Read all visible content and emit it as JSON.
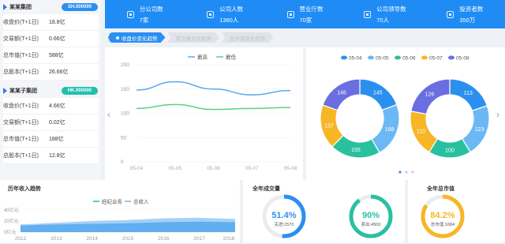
{
  "groups": [
    {
      "name": "某某集团",
      "code": "SH.000000",
      "metrics": [
        {
          "label": "收盘价(T+1日)",
          "value": "18.8亿"
        },
        {
          "label": "交易额(T+1日)",
          "value": "0.66亿"
        },
        {
          "label": "总市值(T+1日)",
          "value": "588亿"
        },
        {
          "label": "总股本(T+1日)",
          "value": "26.66亿"
        }
      ]
    },
    {
      "name": "某某子集团",
      "code": "HK.000000",
      "metrics": [
        {
          "label": "收盘价(T+1日)",
          "value": "4.66亿"
        },
        {
          "label": "交易额(T+1日)",
          "value": "0.02亿"
        },
        {
          "label": "总市值(T+1日)",
          "value": "188亿"
        },
        {
          "label": "总股本(T+1日)",
          "value": "12.8亿"
        }
      ]
    }
  ],
  "stats": [
    {
      "label": "分公司数",
      "value": "7家",
      "icon": "building-icon"
    },
    {
      "label": "公司人数",
      "value": "1360人",
      "icon": "people-icon"
    },
    {
      "label": "营业厅数",
      "value": "70家",
      "icon": "store-icon"
    },
    {
      "label": "公司领导数",
      "value": "70人",
      "icon": "leader-icon"
    },
    {
      "label": "投资者数",
      "value": "350万",
      "icon": "investor-icon"
    }
  ],
  "tabs": [
    {
      "label": "收盘价变化趋势",
      "active": true
    },
    {
      "label": "成交量变化趋势",
      "active": false
    },
    {
      "label": "总市值变化趋势",
      "active": false
    }
  ],
  "line_chart": {
    "legend": [
      "最高",
      "最低"
    ],
    "colors": [
      "#5aaaf0",
      "#5cd08a"
    ],
    "x": [
      "05-04",
      "05-05",
      "05-06",
      "05-07",
      "05-08"
    ],
    "y_ticks": [
      "200",
      "150",
      "100",
      "50",
      "0"
    ],
    "ylim": [
      0,
      200
    ],
    "series": [
      {
        "name": "最高",
        "values": [
          148,
          165,
          150,
          138,
          147
        ]
      },
      {
        "name": "最低",
        "values": [
          110,
          118,
          108,
          110,
          112
        ]
      }
    ]
  },
  "donut_chart": {
    "legend": [
      "05-04",
      "05-05",
      "05-06",
      "05-07",
      "05-08"
    ],
    "colors": [
      "#2b8ff0",
      "#6cb8f5",
      "#29c0a0",
      "#f7b625",
      "#6a6ee0"
    ],
    "left": [
      145,
      168,
      155,
      137,
      146
    ],
    "right": [
      113,
      123,
      100,
      110,
      126
    ]
  },
  "income_chart": {
    "title": "历年收入趋势",
    "legend": [
      "经纪业务",
      "总收入"
    ],
    "colors": [
      "#29c0a0",
      "#6cb8f5"
    ],
    "x": [
      "2012",
      "2013",
      "2014",
      "2015",
      "2016",
      "2017",
      "2018"
    ],
    "y_ticks": [
      "40亿元",
      "20亿元",
      "0亿元"
    ],
    "ylim": [
      0,
      40
    ],
    "series": [
      {
        "name": "经纪业务",
        "values": [
          12,
          14,
          15,
          16,
          18,
          19,
          18
        ]
      },
      {
        "name": "总收入",
        "values": [
          14,
          17,
          20,
          22,
          25,
          26,
          24
        ]
      }
    ]
  },
  "volume": {
    "title": "全年成交量",
    "gauges": [
      {
        "pct": "51.4%",
        "sub": "买进:2570",
        "value": 0.514
      },
      {
        "pct": "90%",
        "sub": "卖出:4500",
        "value": 0.9
      }
    ]
  },
  "market_value": {
    "title": "全年总市值",
    "gauge": {
      "pct": "84.2%",
      "sub": "总市值:1684",
      "value": 0.842
    }
  },
  "chart_data": [
    {
      "type": "line",
      "categories": [
        "05-04",
        "05-05",
        "05-06",
        "05-07",
        "05-08"
      ],
      "series": [
        {
          "name": "最高",
          "values": [
            148,
            165,
            150,
            138,
            147
          ]
        },
        {
          "name": "最低",
          "values": [
            110,
            118,
            108,
            110,
            112
          ]
        }
      ],
      "ylim": [
        0,
        200
      ]
    },
    {
      "type": "pie",
      "categories": [
        "05-04",
        "05-05",
        "05-06",
        "05-07",
        "05-08"
      ],
      "series": [
        {
          "values": [
            145,
            168,
            155,
            137,
            146
          ]
        },
        {
          "values": [
            113,
            123,
            100,
            110,
            126
          ]
        }
      ]
    },
    {
      "type": "area",
      "title": "历年收入趋势",
      "categories": [
        "2012",
        "2013",
        "2014",
        "2015",
        "2016",
        "2017",
        "2018"
      ],
      "series": [
        {
          "name": "经纪业务",
          "values": [
            12,
            14,
            15,
            16,
            18,
            19,
            18
          ]
        },
        {
          "name": "总收入",
          "values": [
            14,
            17,
            20,
            22,
            25,
            26,
            24
          ]
        }
      ],
      "ylim": [
        0,
        40
      ]
    }
  ]
}
